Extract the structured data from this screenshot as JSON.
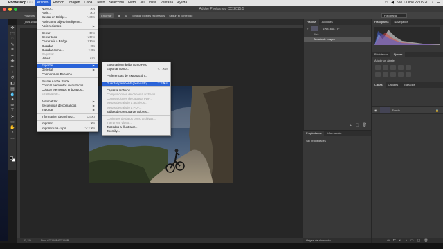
{
  "menubar": {
    "app_name": "Photoshop CC",
    "menus": [
      "Archivo",
      "Edición",
      "Imagen",
      "Capa",
      "Texto",
      "Selección",
      "Filtro",
      "3D",
      "Vista",
      "Ventana",
      "Ayuda"
    ],
    "clock": "Vie 13 ene  22:05:20"
  },
  "window": {
    "title": "Adobe Photoshop CC 2015.5"
  },
  "options_bar": {
    "mode_label": "Proyectar",
    "btn1": "Entornar",
    "btn2": "Eliminar píxeles recortados",
    "btn3": "Según el contenido",
    "workspace": "Fotografía"
  },
  "document": {
    "tab": "_LW81668.tif @ 11,1% (RGB/16*)",
    "zoom": "11,1%",
    "doc_info": "Doc: 67,1 MB/67,1 MB"
  },
  "archivo_menu": [
    {
      "label": "Nuevo...",
      "sc": "⌘N"
    },
    {
      "label": "Abrir...",
      "sc": "⌘O"
    },
    {
      "label": "Buscar en Bridge...",
      "sc": "⌥⌘O"
    },
    {
      "label": "Abrir como objeto inteligente...",
      "sc": ""
    },
    {
      "label": "Abrir recientes",
      "sc": "▶"
    },
    {
      "sep": true
    },
    {
      "label": "Cerrar",
      "sc": "⌘W"
    },
    {
      "label": "Cerrar todo",
      "sc": "⌥⌘W"
    },
    {
      "label": "Cerrar e ir a Bridge...",
      "sc": "⇧⌘W"
    },
    {
      "label": "Guardar",
      "sc": "⌘S"
    },
    {
      "label": "Guardar como...",
      "sc": "⇧⌘S"
    },
    {
      "label": "Registrar...",
      "sc": "",
      "dis": true
    },
    {
      "label": "Volver",
      "sc": "F12"
    },
    {
      "sep": true
    },
    {
      "label": "Exportar",
      "sc": "▶",
      "hl": true
    },
    {
      "label": "Generar",
      "sc": "▶"
    },
    {
      "label": "Compartir en Behance...",
      "sc": ""
    },
    {
      "sep": true
    },
    {
      "label": "Buscar Adobe Stock...",
      "sc": ""
    },
    {
      "label": "Colocar elementos incrustados...",
      "sc": ""
    },
    {
      "label": "Colocar elementos enlazados...",
      "sc": ""
    },
    {
      "label": "Empaquetar...",
      "sc": "",
      "dis": true
    },
    {
      "sep": true
    },
    {
      "label": "Automatizar",
      "sc": "▶"
    },
    {
      "label": "Secuencias de comandos",
      "sc": "▶"
    },
    {
      "label": "Importar",
      "sc": "▶"
    },
    {
      "sep": true
    },
    {
      "label": "Información de archivo...",
      "sc": "⌥⇧⌘I"
    },
    {
      "sep": true
    },
    {
      "label": "Imprimir...",
      "sc": "⌘P"
    },
    {
      "label": "Imprimir una copia",
      "sc": "⌥⇧⌘P"
    }
  ],
  "exportar_menu": [
    {
      "label": "Exportación rápida como PNG",
      "sc": ""
    },
    {
      "label": "Exportar como...",
      "sc": "⌥⇧⌘W"
    },
    {
      "sep": true
    },
    {
      "label": "Preferencias de exportación...",
      "sc": ""
    },
    {
      "sep": true
    },
    {
      "label": "Guardar para Web (heredado)...",
      "sc": "⌥⇧⌘S",
      "hl": true
    },
    {
      "sep": true
    },
    {
      "label": "Capas a archivos...",
      "sc": ""
    },
    {
      "label": "Composiciones de capas a archivos...",
      "sc": "",
      "dis": true
    },
    {
      "label": "Composiciones de capas a PDF...",
      "sc": "",
      "dis": true
    },
    {
      "label": "Mesas de trabajo a archivos...",
      "sc": "",
      "dis": true
    },
    {
      "label": "Mesas de trabajo a PDF...",
      "sc": "",
      "dis": true
    },
    {
      "label": "Tablas de consulta de colores...",
      "sc": ""
    },
    {
      "sep": true
    },
    {
      "label": "Conjuntos de datos como archivos...",
      "sc": "",
      "dis": true
    },
    {
      "label": "Interpretar vídeo...",
      "sc": "",
      "dis": true
    },
    {
      "label": "Trazados a Illustrator...",
      "sc": ""
    },
    {
      "label": "Zoomify...",
      "sc": ""
    }
  ],
  "history_panel": {
    "tabs": [
      "Historia",
      "Acciones"
    ],
    "snapshot": "_LW81668.TIF",
    "rows": [
      "Abrir",
      "Tamaño de imagen"
    ]
  },
  "properties_panel": {
    "tabs": [
      "Propiedades",
      "Información"
    ],
    "empty": "Sin propiedades"
  },
  "clone_panel": {
    "title": "Origen de clonación"
  },
  "right_panels": {
    "histogram_tabs": [
      "Histograma",
      "Navegador"
    ],
    "lib_tabs": [
      "Bibliotecas",
      "Ajustes"
    ],
    "adj_title": "Añadir un ajuste",
    "layer_tabs": [
      "Capas",
      "Canales",
      "Trazados"
    ],
    "layer_name": "Fondo"
  },
  "colors": {
    "accent": "#2a63d8",
    "panel": "#383838",
    "menu_bg": "#ececec"
  }
}
